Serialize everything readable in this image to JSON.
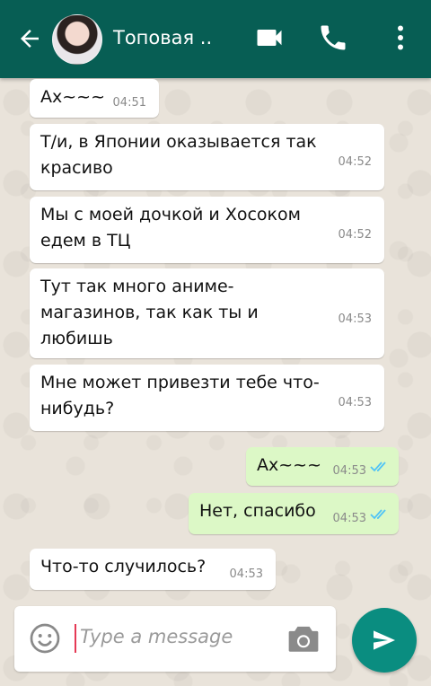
{
  "header": {
    "contact_name": "Топовая ..",
    "back_icon": "back-arrow-icon",
    "avatar_icon": "contact-avatar",
    "actions": [
      "video-call-icon",
      "voice-call-icon",
      "more-vert-icon"
    ],
    "bar_color": "#075e54"
  },
  "messages": [
    {
      "text": "Ах~~~",
      "time": "04:51",
      "direction": "in"
    },
    {
      "text": "Т/и, в Японии оказывается так красиво",
      "time": "04:52",
      "direction": "in"
    },
    {
      "text": "Мы с моей дочкой и Хосоком едем в ТЦ",
      "time": "04:52",
      "direction": "in"
    },
    {
      "text": "Тут так много аниме-магазинов, так как ты и любишь",
      "time": "04:53",
      "direction": "in"
    },
    {
      "text": "Мне может привезти тебе что-нибудь?",
      "time": "04:53",
      "direction": "in"
    },
    {
      "text": "Ах~~~",
      "time": "04:53",
      "direction": "out",
      "status": "read"
    },
    {
      "text": "Нет, спасибо",
      "time": "04:53",
      "direction": "out",
      "status": "read"
    },
    {
      "text": "Что-то случилось?",
      "time": "04:53",
      "direction": "in"
    }
  ],
  "composer": {
    "placeholder": "Type a message",
    "emoji_icon": "emoji-icon",
    "camera_icon": "camera-icon",
    "send_icon": "send-icon",
    "send_color": "#0a8d80"
  },
  "colors": {
    "incoming_bubble": "#ffffff",
    "outgoing_bubble": "#dcf8c6",
    "read_ticks": "#4fc3f7"
  }
}
